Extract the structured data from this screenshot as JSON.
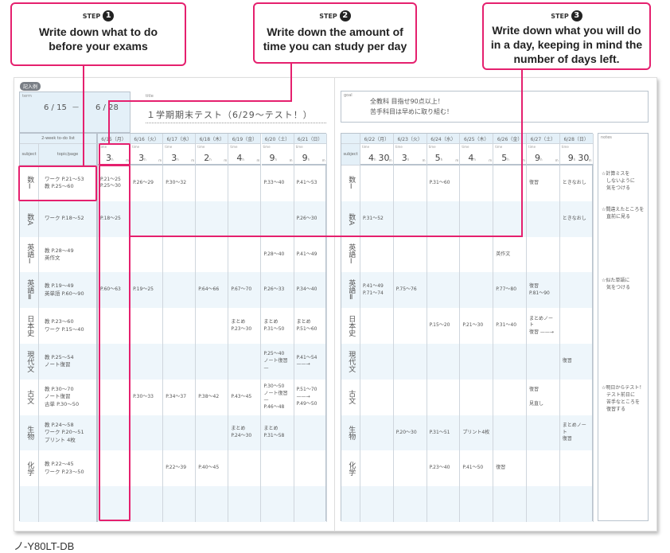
{
  "steps": [
    {
      "label": "STEP",
      "number": "1",
      "text": "Write down what to do before your exams"
    },
    {
      "label": "STEP",
      "number": "2",
      "text": "Write down the amount of time you can study per day"
    },
    {
      "label": "STEP",
      "number": "3",
      "text": "Write down what you will do in a day, keeping in mind the number of days left."
    }
  ],
  "badge": "記入例",
  "term": {
    "label": "term",
    "start": "6 / 15",
    "sep": "—",
    "end": "6 / 28"
  },
  "title": {
    "label": "title",
    "value": "１学期期末テスト（6/29～テスト！）"
  },
  "goal": {
    "label": "goal",
    "value": "全教科 目指せ90点以上！\n苦手科目は早めに取り組む！"
  },
  "headers": {
    "todo": "2-week to-do list",
    "subject": "subject",
    "topic": "topic/page",
    "time": "time",
    "h": "h",
    "m": "m",
    "notes": "notes"
  },
  "days_left": [
    "6/15（月）",
    "6/16（火）",
    "6/17（水）",
    "6/18（木）",
    "6/19（金）",
    "6/20（土）",
    "6/21（日）"
  ],
  "days_right": [
    "6/22（月）",
    "6/23（火）",
    "6/24（水）",
    "6/25（木）",
    "6/26（金）",
    "6/27（土）",
    "6/28（日）"
  ],
  "times_left": [
    {
      "h": "3",
      "m": ""
    },
    {
      "h": "3",
      "m": ""
    },
    {
      "h": "3",
      "m": ""
    },
    {
      "h": "2",
      "m": ""
    },
    {
      "h": "4",
      "m": ""
    },
    {
      "h": "9",
      "m": ""
    },
    {
      "h": "9",
      "m": ""
    }
  ],
  "times_right": [
    {
      "h": "4",
      "m": "30"
    },
    {
      "h": "3",
      "m": ""
    },
    {
      "h": "5",
      "m": ""
    },
    {
      "h": "4",
      "m": ""
    },
    {
      "h": "5",
      "m": ""
    },
    {
      "h": "9",
      "m": ""
    },
    {
      "h": "9",
      "m": "30"
    }
  ],
  "rows": [
    {
      "subject": "数Ⅰ",
      "topic": "ワーク P.21～53\n教 P.25～60",
      "left": [
        "P.21～25\nP.25～30",
        "P.26～29",
        "P.30～32",
        "",
        "",
        "P.33～40",
        "P.41～53"
      ],
      "right": [
        "",
        "",
        "P.31～60",
        "",
        "",
        "復習",
        "ときなおし"
      ]
    },
    {
      "subject": "数A",
      "topic": "ワーク P.18～52",
      "left": [
        "P.18～25",
        "",
        "",
        "",
        "",
        "",
        "P.26～30"
      ],
      "right": [
        "P.31～52",
        "",
        "",
        "",
        "",
        "",
        "ときなおし"
      ]
    },
    {
      "subject": "英語Ⅰ",
      "topic": "教 P.28～49\n英作文",
      "left": [
        "",
        "",
        "",
        "",
        "",
        "P.28～40",
        "P.41～49"
      ],
      "right": [
        "",
        "",
        "",
        "",
        "英作文",
        "",
        ""
      ]
    },
    {
      "subject": "英語Ⅱ",
      "topic": "教 P.19～49\n英単語 P.60～90",
      "left": [
        "P.60～63",
        "P.19～25",
        "",
        "P.64～66",
        "P.67～70",
        "P.26～33",
        "P.34～40"
      ],
      "right": [
        "P.41～49\nP.71～74",
        "P.75～76",
        "",
        "",
        "P.77～80",
        "復習\nP.81～90",
        ""
      ]
    },
    {
      "subject": "日本史",
      "topic": "教 P.23～60\nワーク P.15～40",
      "left": [
        "",
        "",
        "",
        "",
        "まとめ\nP.23～30",
        "まとめ\nP.31～50",
        "まとめ\nP.51～60"
      ],
      "right": [
        "",
        "",
        "P.15～20",
        "P.21～30",
        "P.31～40",
        "まとめノート\n復習 ——→",
        ""
      ]
    },
    {
      "subject": "現代文",
      "topic": "教 P.25～54\nノート復習",
      "left": [
        "",
        "",
        "",
        "",
        "",
        "P.25～40\nノート復習—",
        "P.41～54\n——→"
      ],
      "right": [
        "",
        "",
        "",
        "",
        "",
        "",
        "復習"
      ]
    },
    {
      "subject": "古文",
      "topic": "教 P.30～70\nノート復習\n古単 P.30～50",
      "left": [
        "",
        "P.30～33",
        "P.34～37",
        "P.38～42",
        "P.43～45",
        "P.30～50\nノート復習—\nP.46～48",
        "P.51～70\n——→\nP.49～50"
      ],
      "right": [
        "",
        "",
        "",
        "",
        "",
        "復習\n\n見直し",
        ""
      ]
    },
    {
      "subject": "生物",
      "topic": "教 P.24～58\nワーク P.20～51\nプリント 4枚",
      "left": [
        "",
        "",
        "",
        "",
        "まとめ\nP.24～30",
        "まとめ\nP.31～58",
        ""
      ],
      "right": [
        "",
        "P.20～30",
        "P.31～51",
        "プリント4枚",
        "",
        "",
        "まとめノート\n復習"
      ]
    },
    {
      "subject": "化学",
      "topic": "教 P.22～45\nワーク P.23～50",
      "left": [
        "",
        "",
        "P.22～39",
        "P.40～45",
        "",
        "",
        ""
      ],
      "right": [
        "",
        "",
        "P.23～40",
        "P.41～50",
        "復習",
        "",
        ""
      ]
    },
    {
      "subject": "",
      "topic": "",
      "left": [
        "",
        "",
        "",
        "",
        "",
        "",
        ""
      ],
      "right": [
        "",
        "",
        "",
        "",
        "",
        "",
        ""
      ]
    }
  ],
  "notes": [
    {
      "row": 0,
      "text": "☆計算ミスを\n　しないように\n　気をつける"
    },
    {
      "row": 1,
      "text": "☆間違えたところを\n　直前に見る"
    },
    {
      "row": 3,
      "text": "☆似た単語に\n　気をつける"
    },
    {
      "row": 6,
      "text": "☆明日からテスト！\n　テスト前日に\n　苦手なところを\n　復習する"
    }
  ],
  "model": "ノ-Y80LT-DB",
  "colors": {
    "accent": "#e5206e",
    "row_alt": "#eef6fb",
    "header": "#e4f0f8"
  }
}
